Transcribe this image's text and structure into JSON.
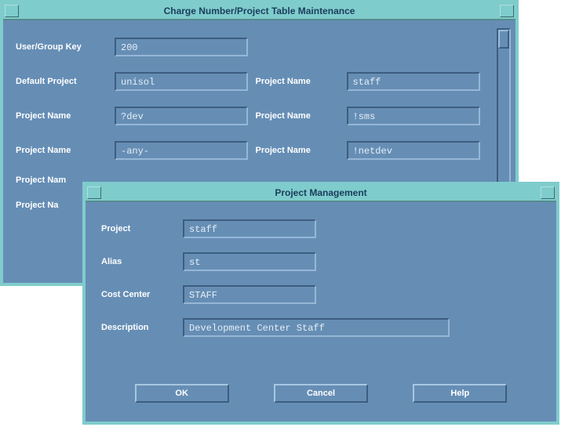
{
  "charge_window": {
    "title": "Charge Number/Project Table Maintenance",
    "labels": {
      "user_group_key": "User/Group Key",
      "default_project": "Default Project",
      "project_name": "Project Name",
      "project_nam_cut": "Project Nam",
      "project_na_cut": "Project Na"
    },
    "values": {
      "user_group_key": "200",
      "default_project": "unisol",
      "project_name_r2c2": "staff",
      "project_name_r3c1": "?dev",
      "project_name_r3c2": "!sms",
      "project_name_r4c1": "-any-",
      "project_name_r4c2": "!netdev"
    }
  },
  "pm_window": {
    "title": "Project Management",
    "labels": {
      "project": "Project",
      "alias": "Alias",
      "cost_center": "Cost Center",
      "description": "Description"
    },
    "values": {
      "project": "staff",
      "alias": "st",
      "cost_center": "STAFF",
      "description": "Development Center Staff"
    },
    "buttons": {
      "ok": "OK",
      "cancel": "Cancel",
      "help": "Help"
    }
  }
}
